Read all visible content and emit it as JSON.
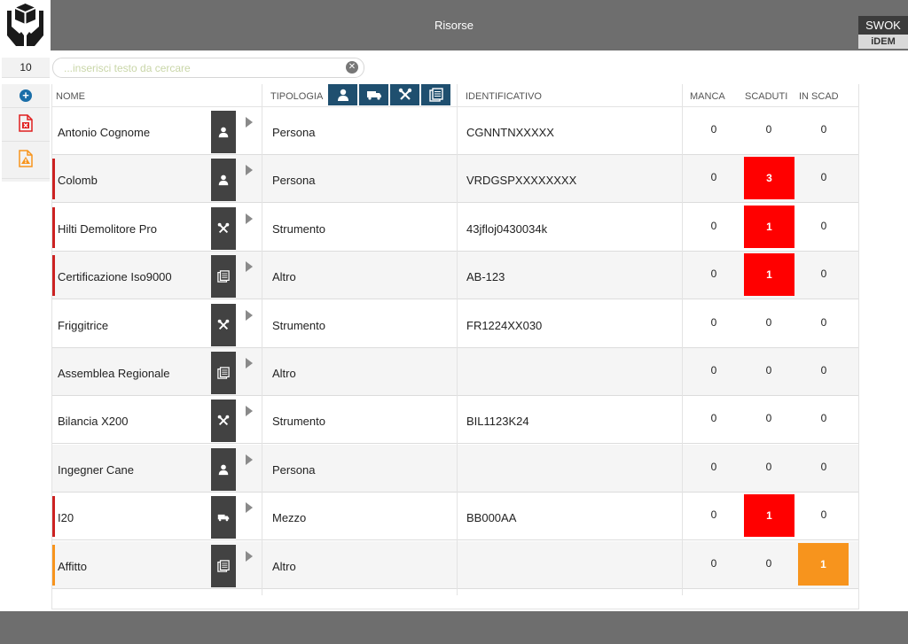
{
  "header": {
    "title": "Risorse",
    "brand_top": "SWOK",
    "brand_bottom": "iDEM"
  },
  "search": {
    "count": "10",
    "placeholder": "...inserisci testo da cercare"
  },
  "columns": {
    "nome": "NOME",
    "tipologia": "TIPOLOGIA",
    "identificativo": "IDENTIFICATIVO",
    "manca": "MANCA",
    "scaduti": "SCADUTI",
    "in_scad": "IN SCAD"
  },
  "filters": [
    "person-icon",
    "truck-icon",
    "tools-icon",
    "document-icon"
  ],
  "colors": {
    "expired": "#ff0000",
    "expiring": "#f7941d",
    "marker_red": "#cc2222",
    "marker_orange": "#f7941d",
    "dark_blue": "#1f4f6f"
  },
  "rows": [
    {
      "nome": "Antonio Cognome",
      "tipologia": "Persona",
      "identificativo": "CGNNTNXXXXX",
      "manca": "0",
      "scaduti": "0",
      "in_scad": "0",
      "icon": "person-icon",
      "status": "none"
    },
    {
      "nome": "Colomb",
      "tipologia": "Persona",
      "identificativo": "VRDGSPXXXXXXXX",
      "manca": "0",
      "scaduti": "3",
      "in_scad": "0",
      "icon": "person-icon",
      "status": "red"
    },
    {
      "nome": "Hilti Demolitore Pro",
      "tipologia": "Strumento",
      "identificativo": "43jfloj0430034k",
      "manca": "0",
      "scaduti": "1",
      "in_scad": "0",
      "icon": "tools-icon",
      "status": "red"
    },
    {
      "nome": "Certificazione Iso9000",
      "tipologia": "Altro",
      "identificativo": "AB-123",
      "manca": "0",
      "scaduti": "1",
      "in_scad": "0",
      "icon": "document-icon",
      "status": "red"
    },
    {
      "nome": "Friggitrice",
      "tipologia": "Strumento",
      "identificativo": "FR1224XX030",
      "manca": "0",
      "scaduti": "0",
      "in_scad": "0",
      "icon": "tools-icon",
      "status": "none"
    },
    {
      "nome": "Assemblea Regionale",
      "tipologia": "Altro",
      "identificativo": "",
      "manca": "0",
      "scaduti": "0",
      "in_scad": "0",
      "icon": "document-icon",
      "status": "none"
    },
    {
      "nome": "Bilancia X200",
      "tipologia": "Strumento",
      "identificativo": "BIL1123K24",
      "manca": "0",
      "scaduti": "0",
      "in_scad": "0",
      "icon": "tools-icon",
      "status": "none"
    },
    {
      "nome": "Ingegner Cane",
      "tipologia": "Persona",
      "identificativo": "",
      "manca": "0",
      "scaduti": "0",
      "in_scad": "0",
      "icon": "person-icon",
      "status": "none"
    },
    {
      "nome": "I20",
      "tipologia": "Mezzo",
      "identificativo": "BB000AA",
      "manca": "0",
      "scaduti": "1",
      "in_scad": "0",
      "icon": "truck-icon",
      "status": "red"
    },
    {
      "nome": "Affitto",
      "tipologia": "Altro",
      "identificativo": "",
      "manca": "0",
      "scaduti": "0",
      "in_scad": "1",
      "icon": "document-icon",
      "status": "orange"
    }
  ]
}
